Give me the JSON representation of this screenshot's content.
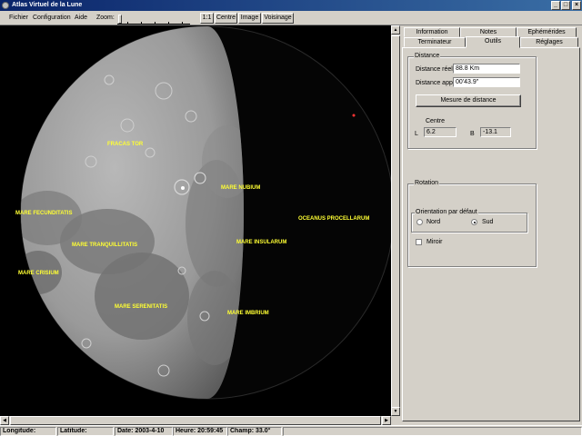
{
  "window": {
    "title": "Atlas Virtuel de la Lune",
    "minimize": "_",
    "maximize": "□",
    "close": "×"
  },
  "menu": [
    "Fichier",
    "Configuration",
    "Aide"
  ],
  "toolbar": {
    "zoom_label": "Zoom:",
    "btn_1_1": "1:1",
    "btn_centre": "Centre",
    "btn_image": "Image",
    "btn_voisinage": "Voisinage"
  },
  "tabs": {
    "row_back": [
      "Information",
      "Notes",
      "Ephémérides"
    ],
    "row_front": [
      "Terminateur",
      "Outils",
      "Réglages"
    ],
    "active": "Outils"
  },
  "distance": {
    "group_title": "Distance",
    "reelle_label": "Distance réelle",
    "reelle_value": "88.8 Km",
    "apparente_label": "Distance apparente",
    "apparente_value": "00'43.9\"",
    "measure_button": "Mesure de distance",
    "centre_label": "Centre",
    "l_label": "L",
    "l_value": "6.2",
    "b_label": "B",
    "b_value": "-13.1"
  },
  "rotation": {
    "group_title": "Rotation",
    "orientation_title": "Orientation par défaut",
    "nord": "Nord",
    "sud": "Sud",
    "selected": "Sud",
    "miroir": "Miroir"
  },
  "moon_labels": {
    "fraguel": "FRACAS TOR",
    "nubium": "MARE NUBIUM",
    "fecunditatis": "MARE FECUNDITATIS",
    "tranquillitatis": "MARE TRANQUILLITATIS",
    "insularum": "MARE INSULARUM",
    "procellarum": "OCEANUS PROCELLARUM",
    "crisium": "MARE CRISIUM",
    "serenitatis": "MARE SERENITATIS",
    "imbrium": "MARE IMBRIUM"
  },
  "status": {
    "longitude_label": "Longitude:",
    "latitude_label": "Latitude:",
    "date": "Date: 2003-4-10",
    "heure": "Heure: 20:59:45",
    "champ": "Champ: 33.0°"
  }
}
